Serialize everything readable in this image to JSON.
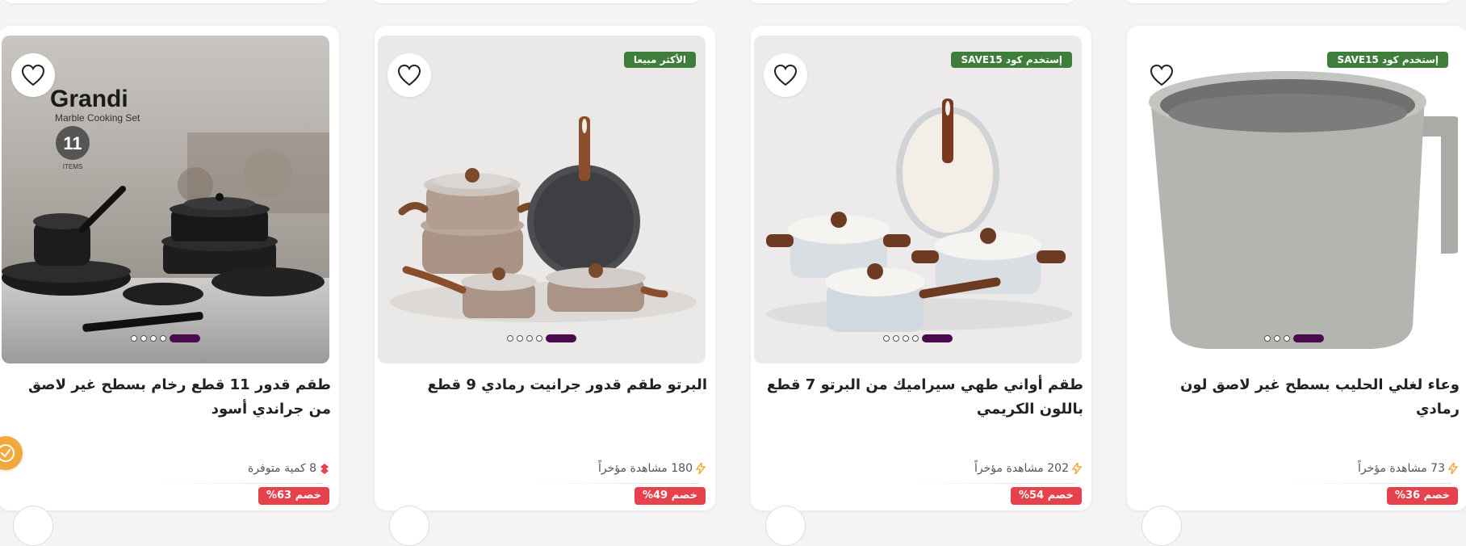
{
  "products": [
    {
      "title": "طقم قدور 11 قطع رخام بسطح غير لاصق من جراندي أسود",
      "badge": "",
      "meta": "8 كمية متوفرة",
      "meta_icon": "fire-icon",
      "discount": "خصم 63%",
      "image_text": {
        "brand": "Grandi",
        "subtitle": "Marble Cooking Set",
        "count": "11",
        "count_label": "ITEMS"
      },
      "slides": 5,
      "active_slide": 5
    },
    {
      "title": "البرتو طقم قدور جرانيت رمادي 9 قطع",
      "badge": "الأكثر مبيعا",
      "meta": "180 مشاهدة مؤخراً",
      "meta_icon": "lightning-icon",
      "discount": "خصم 49%",
      "slides": 5,
      "active_slide": 5
    },
    {
      "title": "طقم أواني طهي سيراميك من البرتو 7 قطع باللون الكريمي",
      "badge": "إستخدم كود SAVE15",
      "meta": "202 مشاهدة مؤخراً",
      "meta_icon": "lightning-icon",
      "discount": "خصم 54%",
      "slides": 5,
      "active_slide": 5
    },
    {
      "title": "وعاء لغلي الحليب بسطح غير لاصق لون رمادي",
      "badge": "إستخدم كود SAVE15",
      "meta": "73 مشاهدة مؤخراً",
      "meta_icon": "lightning-icon",
      "discount": "خصم 36%",
      "slides": 4,
      "active_slide": 4
    }
  ],
  "colors": {
    "badge_green": "#3e7d3a",
    "discount_red": "#e5424b",
    "active_dot": "#4a0a4e",
    "lightning": "#f2a93b",
    "fire": "#e5424b",
    "chat_fab": "#f2a93b"
  }
}
